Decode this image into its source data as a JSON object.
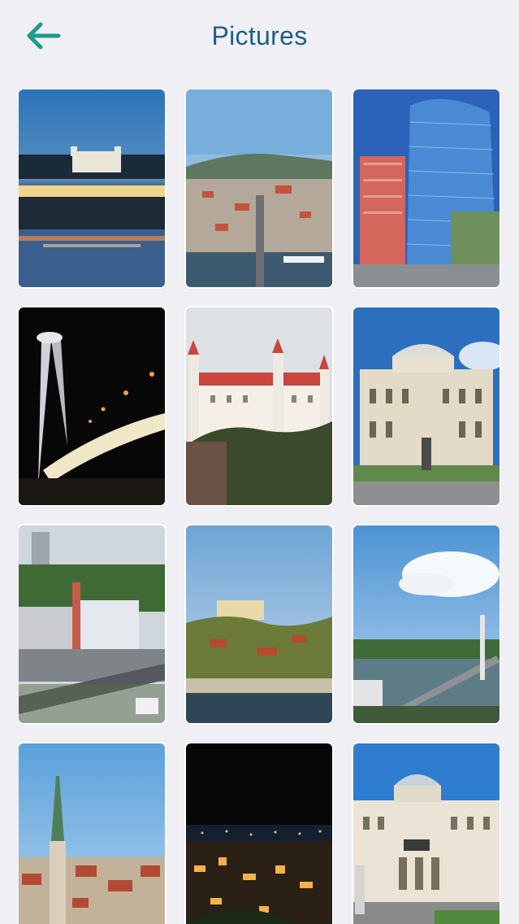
{
  "header": {
    "title": "Pictures",
    "back_icon": "arrow-left-icon",
    "accent_color": "#1f9a8a"
  },
  "gallery": {
    "items": [
      {
        "name": "castle-night-bridge"
      },
      {
        "name": "city-aerial-bridge"
      },
      {
        "name": "glass-tower"
      },
      {
        "name": "ufo-bridge-night"
      },
      {
        "name": "bratislava-castle"
      },
      {
        "name": "theatre-building"
      },
      {
        "name": "city-intersection"
      },
      {
        "name": "castle-hill-river"
      },
      {
        "name": "danube-bridge"
      },
      {
        "name": "cathedral-spire"
      },
      {
        "name": "city-night"
      },
      {
        "name": "opera-house"
      }
    ]
  }
}
